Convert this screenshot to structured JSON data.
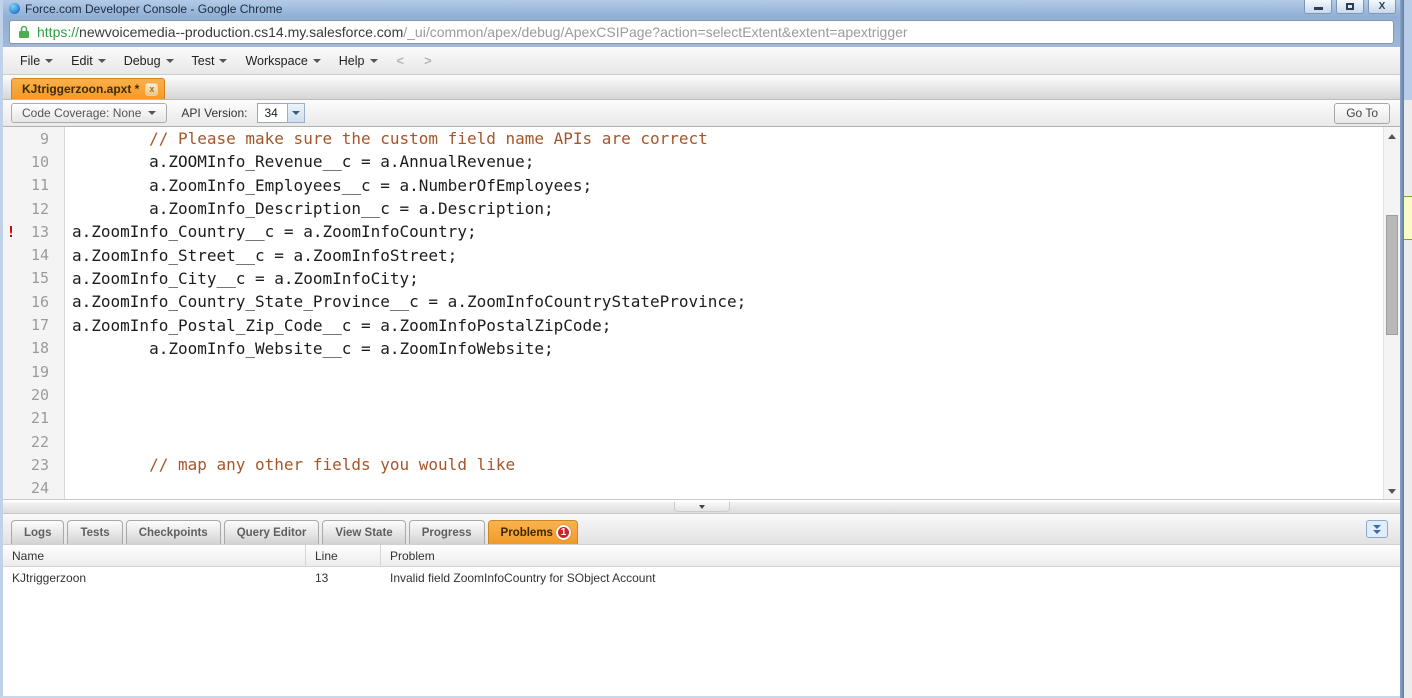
{
  "window": {
    "title": "Force.com Developer Console - Google Chrome"
  },
  "browser": {
    "url_scheme": "https://",
    "url_host": "newvoicemedia--production.cs14.my.salesforce.com",
    "url_path": "/_ui/common/apex/debug/ApexCSIPage?action=selectExtent&extent=apextrigger"
  },
  "menu": {
    "items": [
      "File",
      "Edit",
      "Debug",
      "Test",
      "Workspace",
      "Help"
    ],
    "back_label": "<",
    "forward_label": ">"
  },
  "workspace": {
    "file_tab_label": "KJtriggerzoon.apxt *",
    "file_tab_close": "x"
  },
  "toolbar": {
    "code_coverage_label": "Code Coverage: None",
    "api_version_label": "API Version:",
    "api_version_value": "34",
    "goto_label": "Go To"
  },
  "editor": {
    "lines": [
      {
        "no": "9",
        "text": "        // Please make sure the custom field name APIs are correct",
        "kind": "comment",
        "error": false
      },
      {
        "no": "10",
        "text": "        a.ZOOMInfo_Revenue__c = a.AnnualRevenue;",
        "kind": "code",
        "error": false
      },
      {
        "no": "11",
        "text": "        a.ZoomInfo_Employees__c = a.NumberOfEmployees;",
        "kind": "code",
        "error": false
      },
      {
        "no": "12",
        "text": "        a.ZoomInfo_Description__c = a.Description;",
        "kind": "code",
        "error": false
      },
      {
        "no": "13",
        "text": "a.ZoomInfo_Country__c = a.ZoomInfoCountry;",
        "kind": "code",
        "error": true
      },
      {
        "no": "14",
        "text": "a.ZoomInfo_Street__c = a.ZoomInfoStreet;",
        "kind": "code",
        "error": false
      },
      {
        "no": "15",
        "text": "a.ZoomInfo_City__c = a.ZoomInfoCity;",
        "kind": "code",
        "error": false
      },
      {
        "no": "16",
        "text": "a.ZoomInfo_Country_State_Province__c = a.ZoomInfoCountryStateProvince;",
        "kind": "code",
        "error": false
      },
      {
        "no": "17",
        "text": "a.ZoomInfo_Postal_Zip_Code__c = a.ZoomInfoPostalZipCode;",
        "kind": "code",
        "error": false
      },
      {
        "no": "18",
        "text": "        a.ZoomInfo_Website__c = a.ZoomInfoWebsite;",
        "kind": "code",
        "error": false
      },
      {
        "no": "19",
        "text": "",
        "kind": "code",
        "error": false
      },
      {
        "no": "20",
        "text": "",
        "kind": "code",
        "error": false
      },
      {
        "no": "21",
        "text": "",
        "kind": "code",
        "error": false
      },
      {
        "no": "22",
        "text": "",
        "kind": "code",
        "error": false
      },
      {
        "no": "23",
        "text": "        // map any other fields you would like",
        "kind": "comment",
        "error": false
      },
      {
        "no": "24",
        "text": "",
        "kind": "code",
        "error": false
      }
    ],
    "error_marker": "!"
  },
  "bottom_panel": {
    "tabs": [
      {
        "label": "Logs",
        "active": false
      },
      {
        "label": "Tests",
        "active": false
      },
      {
        "label": "Checkpoints",
        "active": false
      },
      {
        "label": "Query Editor",
        "active": false
      },
      {
        "label": "View State",
        "active": false
      },
      {
        "label": "Progress",
        "active": false
      },
      {
        "label": "Problems",
        "active": true,
        "badge": "1"
      }
    ],
    "problems_table": {
      "columns": [
        "Name",
        "Line",
        "Problem"
      ],
      "rows": [
        {
          "name": "KJtriggerzoon",
          "line": "13",
          "problem": "Invalid field ZoomInfoCountry for SObject Account"
        }
      ]
    }
  },
  "colors": {
    "accent_orange": "#f7a336",
    "error_red": "#cc0000",
    "comment_brown": "#a5562a",
    "badge_red": "#c62828",
    "url_scheme_green": "#2f9e44",
    "titlebar_blue": "#9db8d8"
  }
}
